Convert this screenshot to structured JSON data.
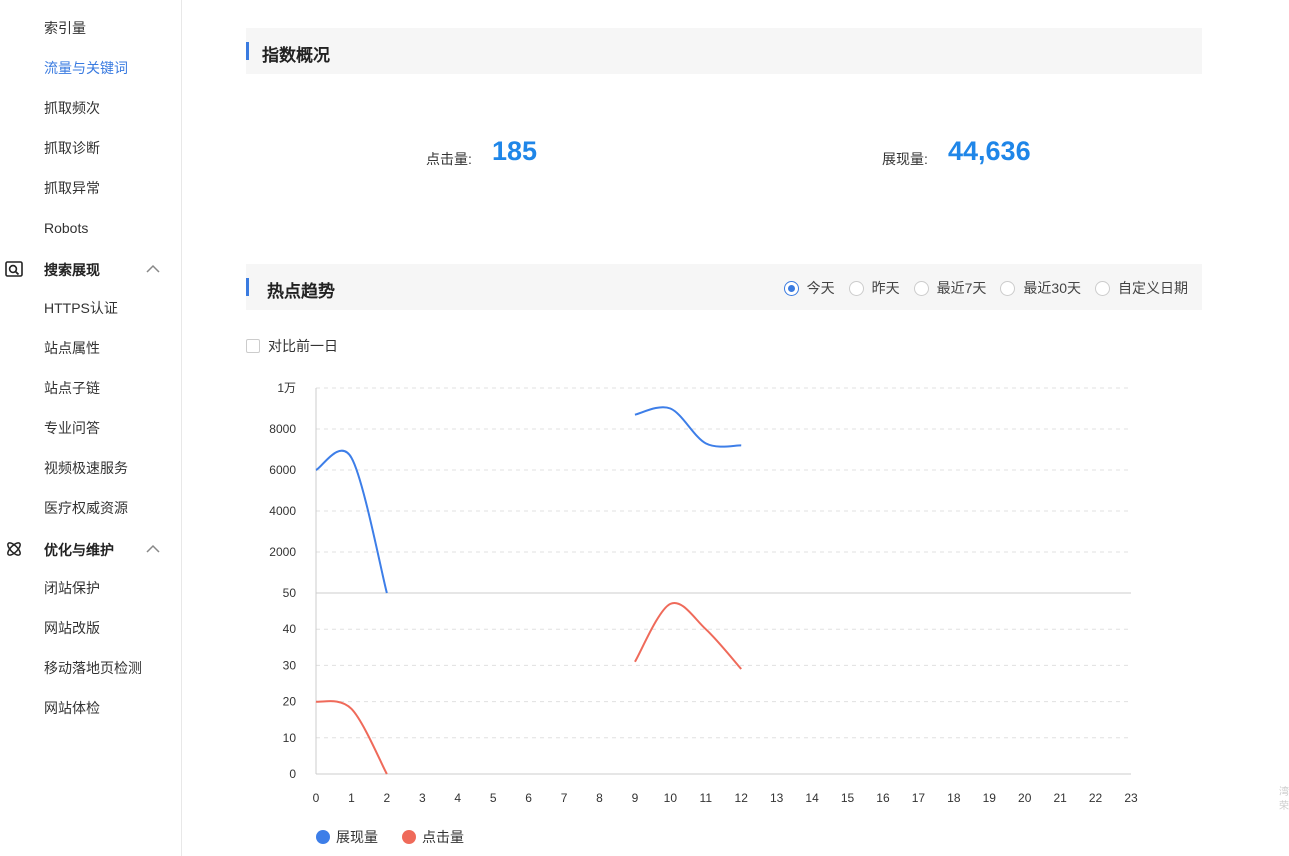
{
  "sidebar": {
    "items_top": [
      {
        "label": "索引量"
      },
      {
        "label": "流量与关键词",
        "active": true
      },
      {
        "label": "抓取频次"
      },
      {
        "label": "抓取诊断"
      },
      {
        "label": "抓取异常"
      },
      {
        "label": "Robots"
      }
    ],
    "group_search": {
      "label": "搜索展现",
      "icon": "search-window-icon",
      "expanded": true
    },
    "items_search": [
      {
        "label": "HTTPS认证"
      },
      {
        "label": "站点属性"
      },
      {
        "label": "站点子链"
      },
      {
        "label": "专业问答"
      },
      {
        "label": "视频极速服务"
      },
      {
        "label": "医疗权威资源"
      }
    ],
    "group_optimize": {
      "label": "优化与维护",
      "icon": "atom-icon",
      "expanded": true
    },
    "items_optimize": [
      {
        "label": "闭站保护"
      },
      {
        "label": "网站改版"
      },
      {
        "label": "移动落地页检测"
      },
      {
        "label": "网站体检"
      }
    ]
  },
  "overview": {
    "title": "指数概况",
    "clicks_label": "点击量:",
    "clicks_value": "185",
    "impressions_label": "展现量:",
    "impressions_value": "44,636"
  },
  "trend": {
    "title": "热点趋势",
    "ranges": [
      {
        "label": "今天",
        "checked": true
      },
      {
        "label": "昨天",
        "checked": false
      },
      {
        "label": "最近7天",
        "checked": false
      },
      {
        "label": "最近30天",
        "checked": false
      },
      {
        "label": "自定义日期",
        "checked": false
      }
    ],
    "compare_label": "对比前一日"
  },
  "colors": {
    "accent": "#3a7be0",
    "impressions": "#3d7ee8",
    "clicks": "#ef6a5a",
    "value": "#1f86e8"
  },
  "chart_data": {
    "type": "line",
    "x": [
      0,
      1,
      2,
      3,
      4,
      5,
      6,
      7,
      8,
      9,
      10,
      11,
      12,
      13,
      14,
      15,
      16,
      17,
      18,
      19,
      20,
      21,
      22,
      23
    ],
    "upper_ticks": [
      "1万",
      "8000",
      "6000",
      "4000",
      "2000"
    ],
    "upper_tick_values": [
      10000,
      8000,
      6000,
      4000,
      2000
    ],
    "lower_ticks": [
      "50",
      "40",
      "30",
      "20",
      "10",
      "0"
    ],
    "lower_tick_values": [
      50,
      40,
      30,
      20,
      10,
      0
    ],
    "series": [
      {
        "name": "展现量",
        "axis": "upper",
        "ylim": [
          0,
          10000
        ],
        "segments": [
          [
            [
              0,
              6000
            ],
            [
              1,
              6600
            ],
            [
              2,
              0
            ]
          ],
          [
            [
              9,
              8700
            ],
            [
              10,
              9000
            ],
            [
              11,
              7300
            ],
            [
              12,
              7200
            ]
          ]
        ]
      },
      {
        "name": "点击量",
        "axis": "lower",
        "ylim": [
          0,
          50
        ],
        "segments": [
          [
            [
              0,
              20
            ],
            [
              1,
              18
            ],
            [
              2,
              0
            ]
          ],
          [
            [
              9,
              31
            ],
            [
              10,
              47
            ],
            [
              11,
              40
            ],
            [
              12,
              29
            ]
          ]
        ]
      }
    ],
    "grid": true,
    "legend_position": "bottom-left"
  },
  "edge_text": "湾 荣"
}
